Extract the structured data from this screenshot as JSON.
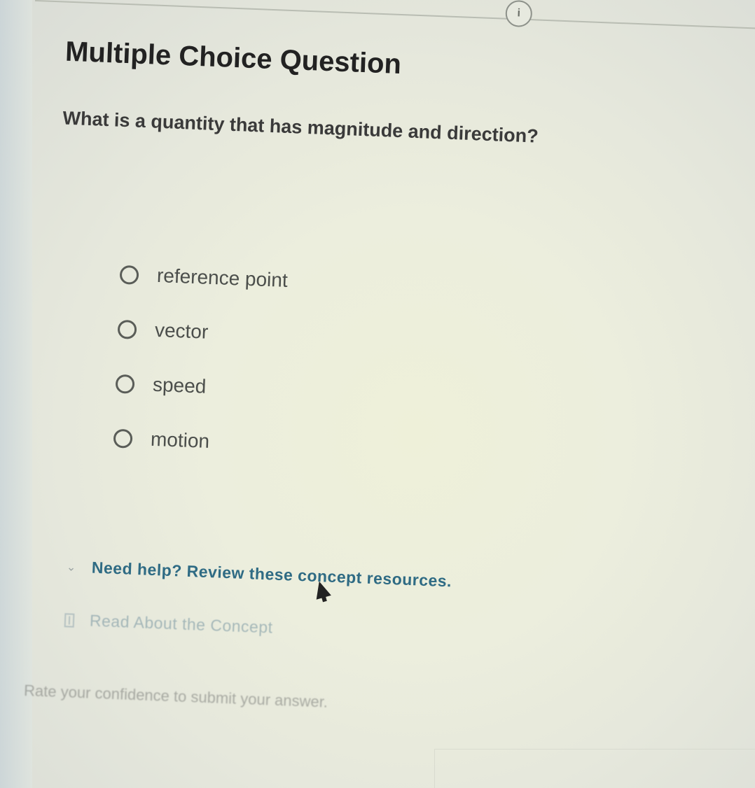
{
  "header": {
    "info_badge": "i"
  },
  "question": {
    "type_label": "Multiple Choice Question",
    "prompt": "What is a quantity that has magnitude and direction?"
  },
  "options": [
    {
      "label": "reference point",
      "selected": false
    },
    {
      "label": "vector",
      "selected": false
    },
    {
      "label": "speed",
      "selected": false
    },
    {
      "label": "motion",
      "selected": false
    }
  ],
  "help": {
    "toggle_label": "Need help? Review these concept resources.",
    "expanded": true,
    "resources": [
      {
        "label": "Read About the Concept",
        "icon": "book-icon"
      }
    ]
  },
  "footer": {
    "confidence_prompt": "Rate your confidence to submit your answer."
  }
}
